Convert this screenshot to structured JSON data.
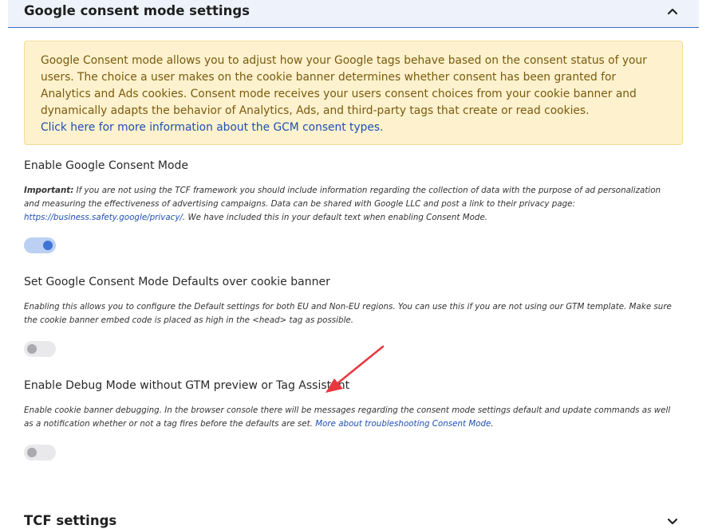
{
  "header": {
    "title": "Google consent mode settings"
  },
  "info": {
    "text": "Google Consent mode allows you to adjust how your Google tags behave based on the consent status of your users. The choice a user makes on the cookie banner determines whether consent has been granted for Analytics and Ads cookies. Consent mode receives your users consent choices from your cookie banner and dynamically adapts the behavior of Analytics, Ads, and third-party tags that create or read cookies.",
    "link": "Click here for more information about the GCM consent types."
  },
  "options": [
    {
      "title": "Enable Google Consent Mode",
      "important_label": "Important:",
      "desc": " If you are not using the TCF framework you should include information regarding the collection of data with the purpose of ad personalization and measuring the effectiveness of advertising campaigns. Data can be shared with Google LLC and post a link to their privacy page: ",
      "link": "https://business.safety.google/privacy/",
      "desc_after": ". We have included this in your default text when enabling Consent Mode.",
      "enabled": true
    },
    {
      "title": "Set Google Consent Mode Defaults over cookie banner",
      "desc": "Enabling this allows you to configure the Default settings for both EU and Non-EU regions. You can use this if you are not using our GTM template. Make sure the cookie banner embed code is placed as high in the <head> tag as possible.",
      "enabled": false
    },
    {
      "title": "Enable Debug Mode without GTM preview or Tag Assistant",
      "desc": "Enable cookie banner debugging. In the browser console there will be messages regarding the consent mode settings default and update commands as well as a notification whether or not a tag fires before the defaults are set. ",
      "link": "More about troubleshooting Consent Mode",
      "desc_after": ".",
      "enabled": false
    }
  ],
  "tcf": {
    "title": "TCF settings"
  },
  "colors": {
    "accent": "#3f73d6",
    "annotation_arrow": "#e8373f",
    "info_bg": "#fdf2cd"
  }
}
